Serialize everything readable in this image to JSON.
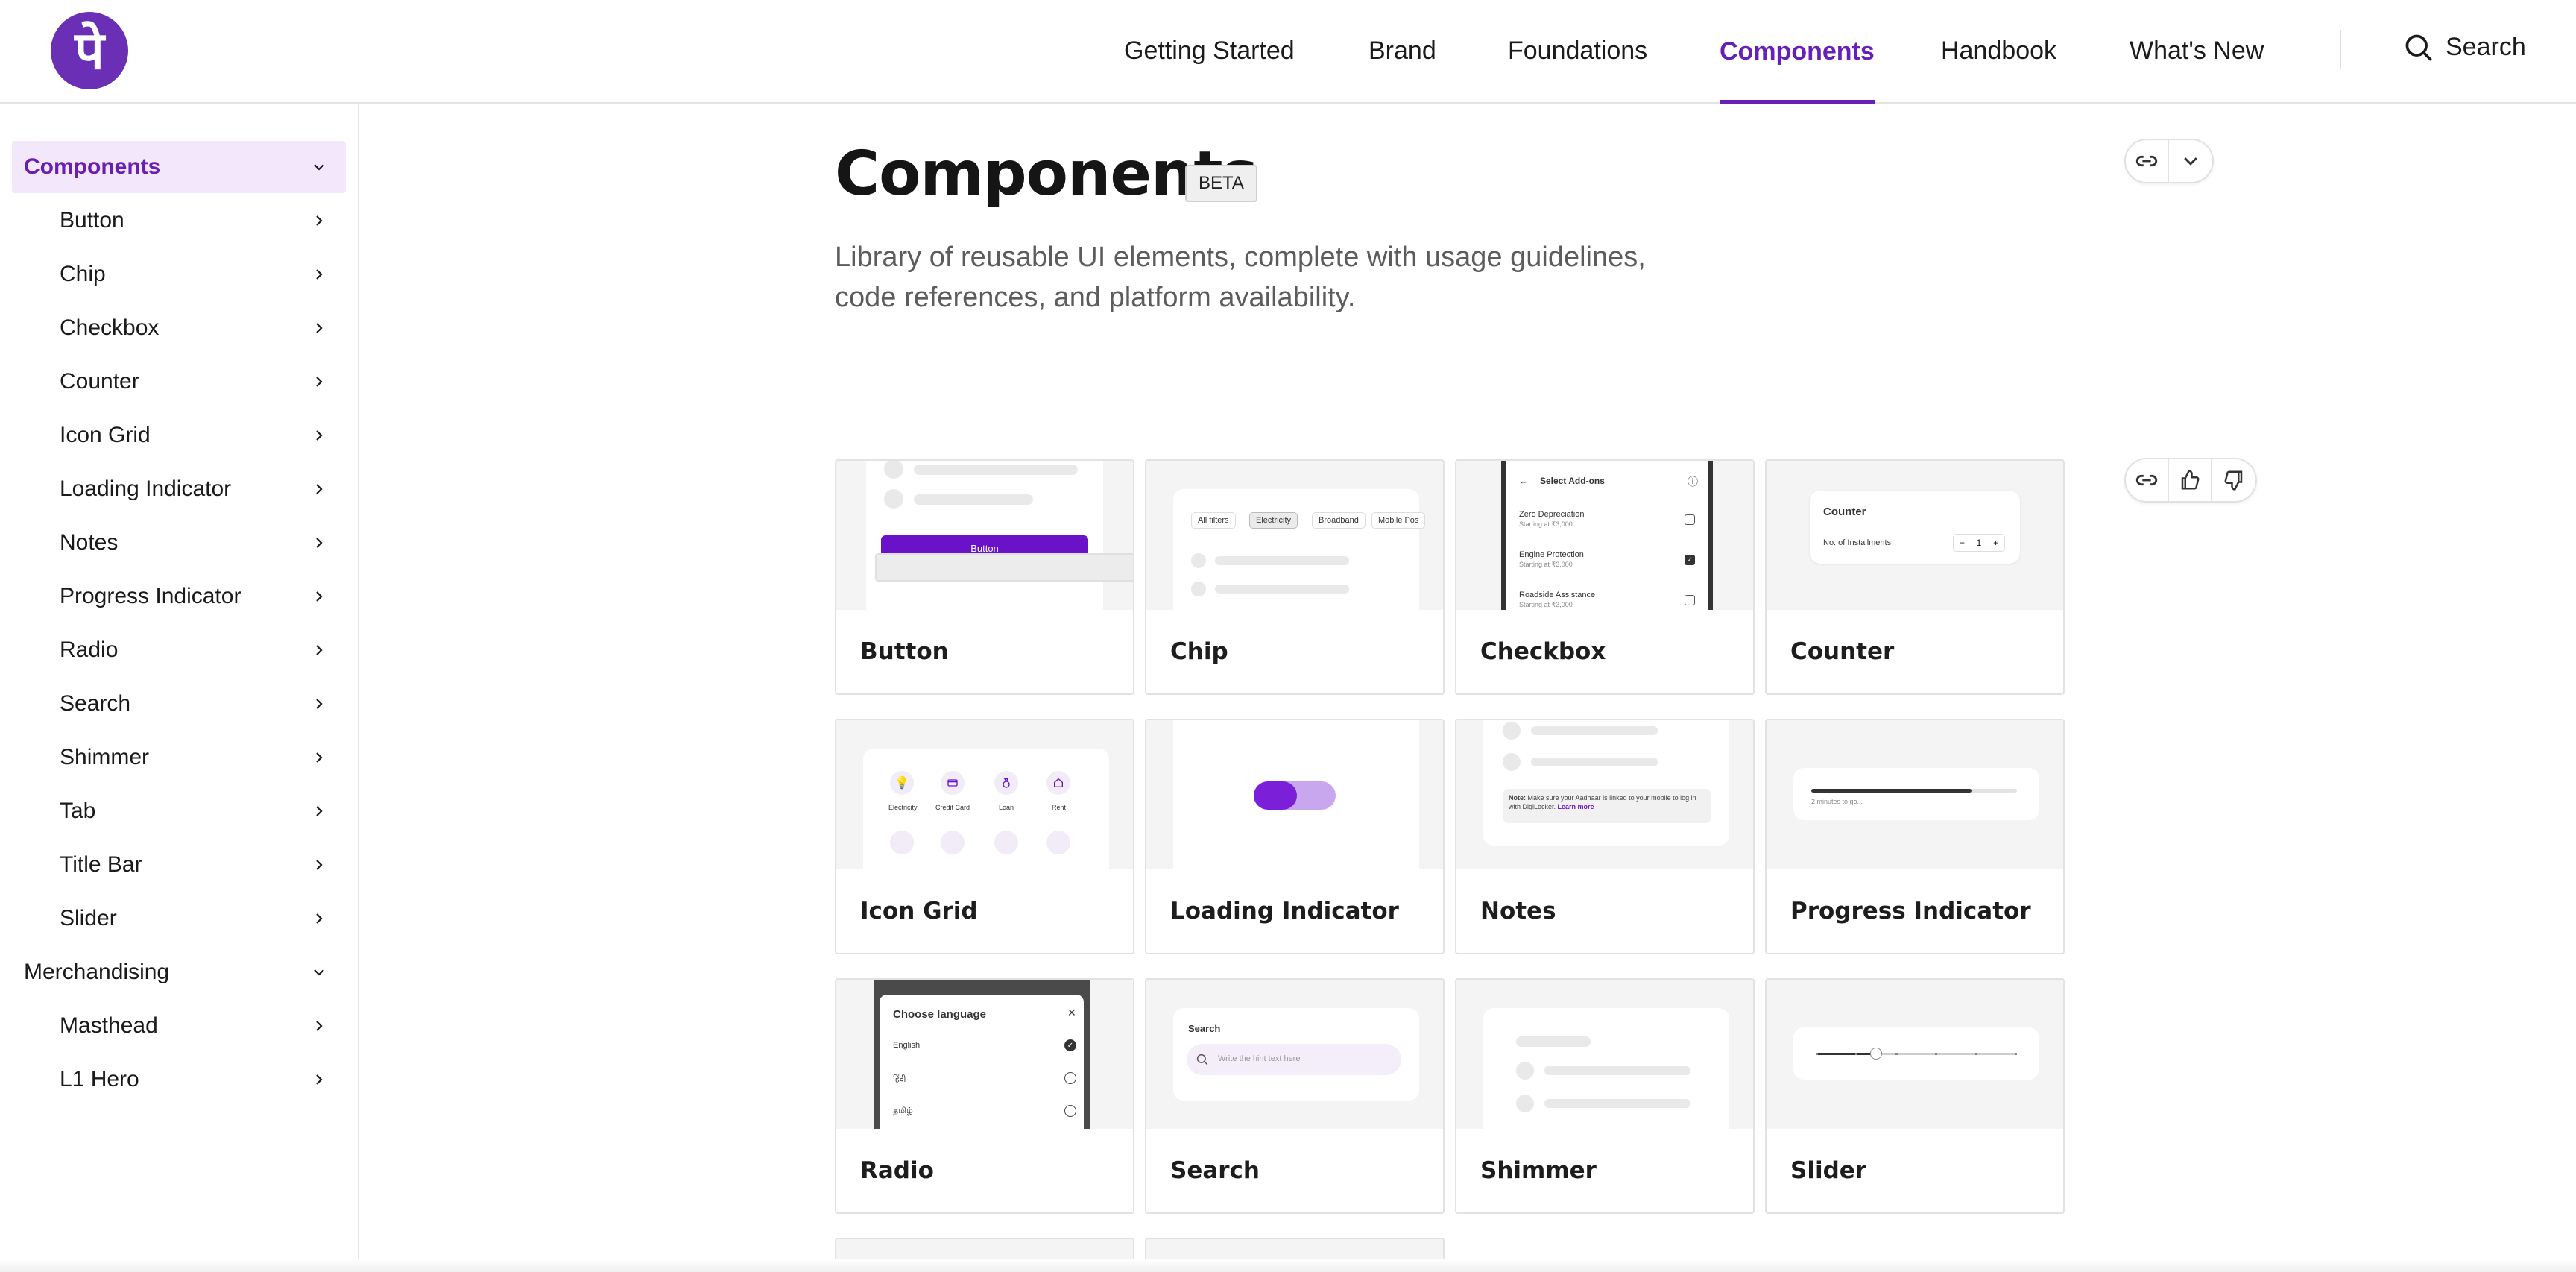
{
  "brand": {
    "logo_glyph": "पे",
    "accent": "#6620b8"
  },
  "nav": {
    "items": [
      "Getting Started",
      "Brand",
      "Foundations",
      "Components",
      "Handbook",
      "What's New"
    ],
    "active": "Components",
    "search_label": "Search"
  },
  "sidebar": {
    "groups": [
      {
        "label": "Components",
        "expanded": true,
        "items": [
          "Button",
          "Chip",
          "Checkbox",
          "Counter",
          "Icon Grid",
          "Loading Indicator",
          "Notes",
          "Progress Indicator",
          "Radio",
          "Search",
          "Shimmer",
          "Tab",
          "Title Bar",
          "Slider"
        ]
      },
      {
        "label": "Merchandising",
        "expanded": true,
        "items": [
          "Masthead",
          "L1 Hero"
        ]
      }
    ]
  },
  "page": {
    "title": "Components",
    "badge": "BETA",
    "description_line1": "Library of reusable UI elements, complete with usage guidelines,",
    "description_line2": "code references, and platform availability."
  },
  "cards": [
    {
      "label": "Button"
    },
    {
      "label": "Chip"
    },
    {
      "label": "Checkbox"
    },
    {
      "label": "Counter"
    },
    {
      "label": "Icon Grid"
    },
    {
      "label": "Loading Indicator"
    },
    {
      "label": "Notes"
    },
    {
      "label": "Progress Indicator"
    },
    {
      "label": "Radio"
    },
    {
      "label": "Search"
    },
    {
      "label": "Shimmer"
    },
    {
      "label": "Slider"
    }
  ],
  "previews": {
    "button_text": "Button",
    "chip_tags": [
      "All filters",
      "Electricity",
      "Broadband",
      "Mobile Pos"
    ],
    "checkbox": {
      "title": "Select Add-ons",
      "options": [
        {
          "name": "Zero Depreciation",
          "sub": "Starting at ₹3,000",
          "checked": false
        },
        {
          "name": "Engine Protection",
          "sub": "Starting at ₹3,000",
          "checked": true
        },
        {
          "name": "Roadside Assistance",
          "sub": "Starting at ₹3,000",
          "checked": false
        }
      ]
    },
    "counter": {
      "title": "Counter",
      "row_label": "No. of Installments",
      "minus": "−",
      "value": "1",
      "plus": "+"
    },
    "icon_grid_labels": [
      "Electricity",
      "Credit Card",
      "Loan",
      "Rent"
    ],
    "notes": {
      "bold": "Note:",
      "text": "Make sure your Aadhaar is linked to your mobile to log in with DigiLocker.",
      "link": "Learn more"
    },
    "progress": {
      "caption": "2 minutes to go...",
      "fraction": 0.78
    },
    "radio": {
      "title": "Choose language",
      "close": "✕",
      "options": [
        "English",
        "हिंदी",
        "தமிழ்"
      ],
      "selected": 0
    },
    "search": {
      "title": "Search",
      "placeholder": "Write the hint text here"
    },
    "slider": {
      "position": 0.3
    }
  }
}
